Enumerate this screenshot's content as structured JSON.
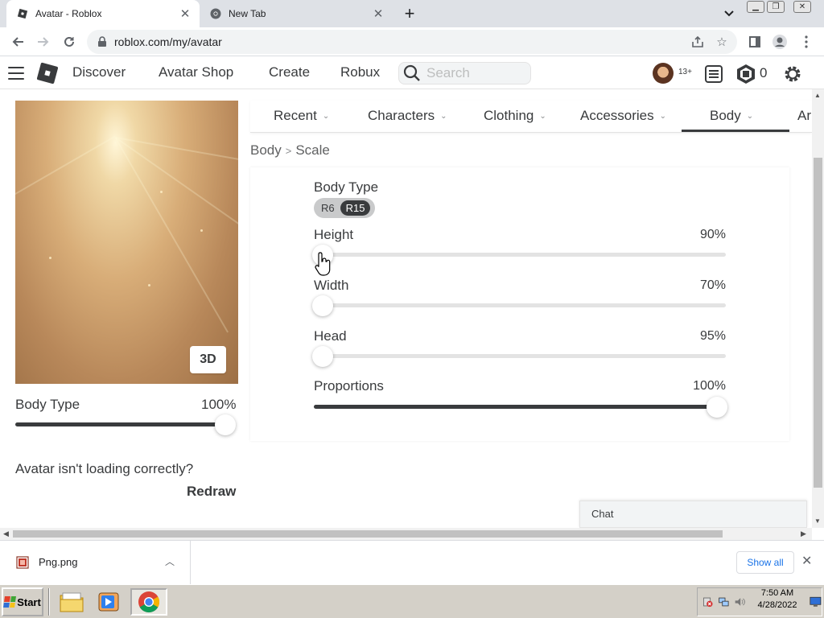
{
  "browser": {
    "tabs": [
      {
        "title": "Avatar - Roblox",
        "active": true
      },
      {
        "title": "New Tab",
        "active": false
      }
    ],
    "url": "roblox.com/my/avatar"
  },
  "header": {
    "nav": [
      "Discover",
      "Avatar Shop",
      "Create",
      "Robux"
    ],
    "search_placeholder": "Search",
    "age_badge": "13+",
    "robux_count": "0"
  },
  "avatar": {
    "view_button": "3D",
    "body_type_label": "Body Type",
    "body_type_value": "100%",
    "body_type_fraction": 1.0,
    "loading_message": "Avatar isn't loading correctly?",
    "redraw_label": "Redraw"
  },
  "categories": {
    "tabs": [
      "Recent",
      "Characters",
      "Clothing",
      "Accessories",
      "Body",
      "Ar"
    ],
    "selected": "Body"
  },
  "breadcrumb": {
    "parent": "Body",
    "current": "Scale"
  },
  "scale": {
    "body_type": {
      "label": "Body Type",
      "options": [
        "R6",
        "R15"
      ],
      "selected": "R15"
    },
    "sliders": [
      {
        "label": "Height",
        "value": "90%",
        "fraction": 0.0
      },
      {
        "label": "Width",
        "value": "70%",
        "fraction": 0.0
      },
      {
        "label": "Head",
        "value": "95%",
        "fraction": 0.0
      },
      {
        "label": "Proportions",
        "value": "100%",
        "fraction": 1.0
      }
    ]
  },
  "chat": {
    "label": "Chat"
  },
  "downloads": {
    "file_name": "Png.png",
    "show_all": "Show all"
  },
  "taskbar": {
    "start_label": "Start",
    "time": "7:50 AM",
    "date": "4/28/2022"
  },
  "colors": {
    "text": "#393b3d",
    "track": "#e3e3e3",
    "accent_link": "#1a73e8"
  }
}
